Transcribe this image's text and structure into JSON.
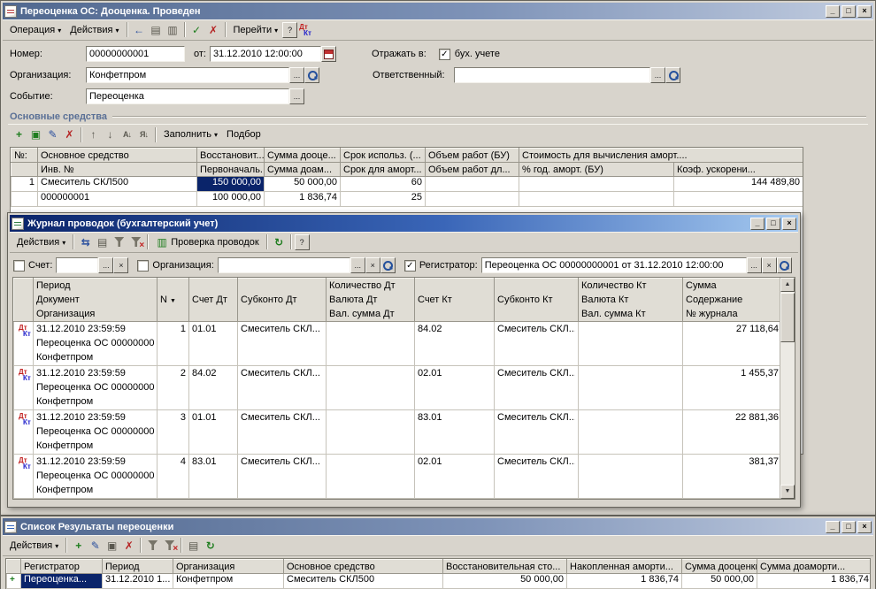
{
  "icons": {
    "dropdown": "▾",
    "tri_up": "▲",
    "tri_down": "▼",
    "minimize": "_",
    "maximize": "□",
    "close": "×",
    "back": "←",
    "ellipsis": "...",
    "clear": "×",
    "check": "✓",
    "cross": "✗",
    "up": "↑",
    "down": "↓",
    "sort_az": "А↓",
    "sort_za": "Я↓",
    "refresh": "↻",
    "help": "?",
    "dt": "Дт",
    "kt": "Кт",
    "add": "+",
    "edit": "✎",
    "copy": "▣",
    "swap": "⇆",
    "grid": "▤",
    "list": "▥"
  },
  "w1": {
    "title": "Переоценка ОС: Дооценка. Проведен",
    "menu": {
      "operation": "Операция",
      "actions": "Действия",
      "goto": "Перейти"
    },
    "form": {
      "number_label": "Номер:",
      "number_value": "00000000001",
      "date_label": "от:",
      "date_value": "31.12.2010 12:00:00",
      "reflect_label": "Отражать в:",
      "buh_label": "бух. учете",
      "org_label": "Организация:",
      "org_value": "Конфетпром",
      "resp_label": "Ответственный:",
      "resp_value": "",
      "event_label": "Событие:",
      "event_value": "Переоценка"
    },
    "section_title": "Основные средства",
    "fill_button": "Заполнить",
    "pick_button": "Подбор",
    "table": {
      "h1": {
        "num": "№:",
        "asset": "Основное средство",
        "restored": "Восстановит...",
        "sum_up": "Сумма дооце...",
        "term": "Срок использ. (...",
        "volume": "Объем работ (БУ)",
        "cost": "Стоимость для вычисления аморт...."
      },
      "h2": {
        "inv": "Инв. №",
        "initial": "Первоначаль...",
        "sum_dep": "Сумма доам...",
        "term": "Срок для аморт...",
        "volume": "Объем работ дл...",
        "pct": "% год. аморт. (БУ)",
        "koef": "Коэф. ускорени..."
      },
      "r1": {
        "num": "1",
        "asset": "Смеситель СКЛ500",
        "restored": "150 000,00",
        "sum_up": "50 000,00",
        "term": "60",
        "cost": "144 489,80"
      },
      "r2": {
        "inv": "000000001",
        "initial": "100 000,00",
        "sum_dep": "1 836,74",
        "term": "25"
      }
    }
  },
  "w2": {
    "title": "Журнал проводок (бухгалтерский учет)",
    "actions": "Действия",
    "check_button": "Проверка проводок",
    "filters": {
      "account_label": "Счет:",
      "account_value": "",
      "org_label": "Организация:",
      "org_value": "",
      "reg_label": "Регистратор:",
      "reg_value": "Переоценка ОС 00000000001 от 31.12.2010 12:00:00"
    },
    "h": {
      "period": "Период",
      "doc": "Документ",
      "org": "Организация",
      "n": "N",
      "acc_dt": "Счет Дт",
      "sub_dt": "Субконто Дт",
      "qty_dt": "Количество Дт",
      "cur_dt": "Валюта Дт",
      "val_dt": "Вал. сумма Дт",
      "acc_kt": "Счет Кт",
      "sub_kt": "Субконто Кт",
      "qty_kt": "Количество Кт",
      "cur_kt": "Валюта Кт",
      "val_kt": "Вал. сумма Кт",
      "sum": "Сумма",
      "content": "Содержание",
      "journal": "№ журнала"
    },
    "rows": [
      {
        "period": "31.12.2010 23:59:59",
        "doc": "Переоценка ОС 00000000...",
        "org": "Конфетпром",
        "n": "1",
        "acc_dt": "01.01",
        "sub_dt": "Смеситель СКЛ...",
        "acc_kt": "84.02",
        "sub_kt": "Смеситель СКЛ...",
        "sum": "27 118,64"
      },
      {
        "period": "31.12.2010 23:59:59",
        "doc": "Переоценка ОС 00000000...",
        "org": "Конфетпром",
        "n": "2",
        "acc_dt": "84.02",
        "sub_dt": "Смеситель СКЛ...",
        "acc_kt": "02.01",
        "sub_kt": "Смеситель СКЛ...",
        "sum": "1 455,37"
      },
      {
        "period": "31.12.2010 23:59:59",
        "doc": "Переоценка ОС 00000000...",
        "org": "Конфетпром",
        "n": "3",
        "acc_dt": "01.01",
        "sub_dt": "Смеситель СКЛ...",
        "acc_kt": "83.01",
        "sub_kt": "Смеситель СКЛ...",
        "sum": "22 881,36"
      },
      {
        "period": "31.12.2010 23:59:59",
        "doc": "Переоценка ОС 00000000...",
        "org": "Конфетпром",
        "n": "4",
        "acc_dt": "83.01",
        "sub_dt": "Смеситель СКЛ...",
        "acc_kt": "02.01",
        "sub_kt": "Смеситель СКЛ...",
        "sum": "381,37"
      }
    ]
  },
  "w3": {
    "title": "Список Результаты переоценки",
    "actions": "Действия",
    "h": {
      "reg": "Регистратор",
      "period": "Период",
      "org": "Организация",
      "asset": "Основное средство",
      "restored": "Восстановительная сто...",
      "accum": "Накопленная аморти...",
      "sum_up": "Сумма дооценки",
      "sum_dep": "Сумма доаморти..."
    },
    "row": {
      "reg": "Переоценка...",
      "period": "31.12.2010 1...",
      "org": "Конфетпром",
      "asset": "Смеситель СКЛ500",
      "restored": "50 000,00",
      "accum": "1 836,74",
      "sum_up": "50 000,00",
      "sum_dep": "1 836,74"
    }
  }
}
